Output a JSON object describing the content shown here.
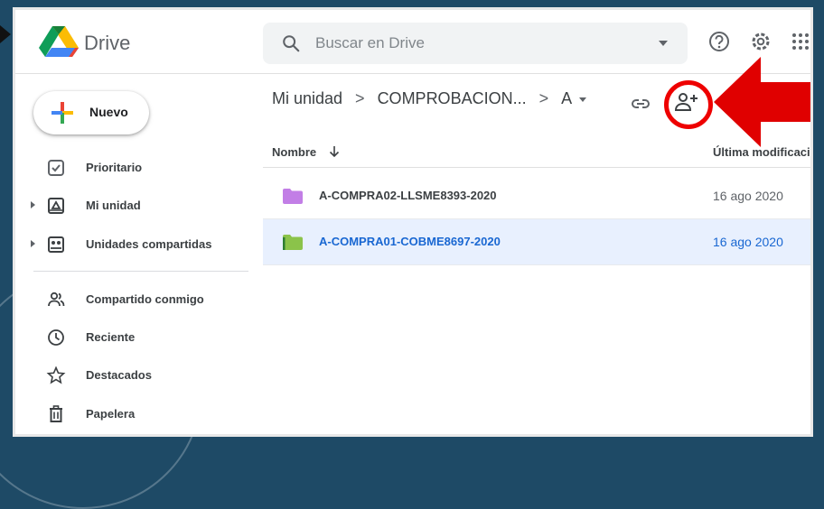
{
  "app": {
    "name": "Drive",
    "search_placeholder": "Buscar en Drive"
  },
  "sidebar": {
    "new_label": "Nuevo",
    "items": [
      {
        "label": "Prioritario",
        "icon": "check-square-icon"
      },
      {
        "label": "Mi unidad",
        "icon": "my-drive-icon"
      },
      {
        "label": "Unidades compartidas",
        "icon": "shared-drives-icon"
      },
      {
        "label": "Compartido conmigo",
        "icon": "people-icon"
      },
      {
        "label": "Reciente",
        "icon": "clock-icon"
      },
      {
        "label": "Destacados",
        "icon": "star-icon"
      },
      {
        "label": "Papelera",
        "icon": "trash-icon"
      }
    ]
  },
  "breadcrumb": {
    "root": "Mi unidad",
    "middle": "COMPROBACION...",
    "current": "A",
    "separator": ">"
  },
  "list": {
    "header_name": "Nombre",
    "header_modified": "Última modificaci...",
    "rows": [
      {
        "name": "A-COMPRA02-LLSME8393-2020",
        "date": "16 ago 2020",
        "folder_color": "#c27ee6",
        "selected": false
      },
      {
        "name": "A-COMPRA01-COBME8697-2020",
        "date": "16 ago 2020",
        "folder_color": "#8bc34a",
        "selected": true
      }
    ]
  },
  "colors": {
    "accent": "#1967d2",
    "highlight_red": "#e00000",
    "background": "#1e4a66"
  }
}
